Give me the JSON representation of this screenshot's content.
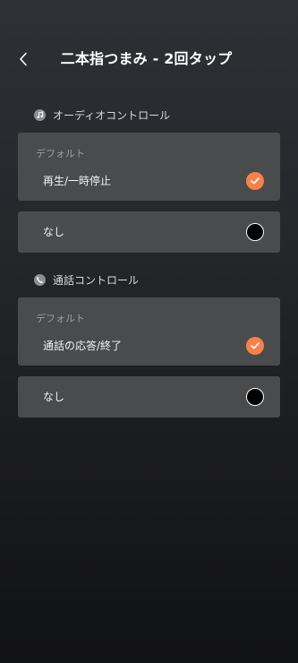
{
  "header": {
    "title": "二本指つまみ - 2回タップ"
  },
  "sections": [
    {
      "title": "オーディオコントロール",
      "icon": "music-note-icon",
      "default_label": "デフォルト",
      "default_option": {
        "label": "再生/一時停止",
        "selected": true
      },
      "none_option": {
        "label": "なし",
        "selected": false
      }
    },
    {
      "title": "通話コントロール",
      "icon": "phone-icon",
      "default_label": "デフォルト",
      "default_option": {
        "label": "通話の応答/終了",
        "selected": true
      },
      "none_option": {
        "label": "なし",
        "selected": false
      }
    }
  ],
  "colors": {
    "accent": "#f5824a",
    "card": "#4a4b4d",
    "background_top": "#2e3035",
    "background_bottom": "#111214"
  }
}
